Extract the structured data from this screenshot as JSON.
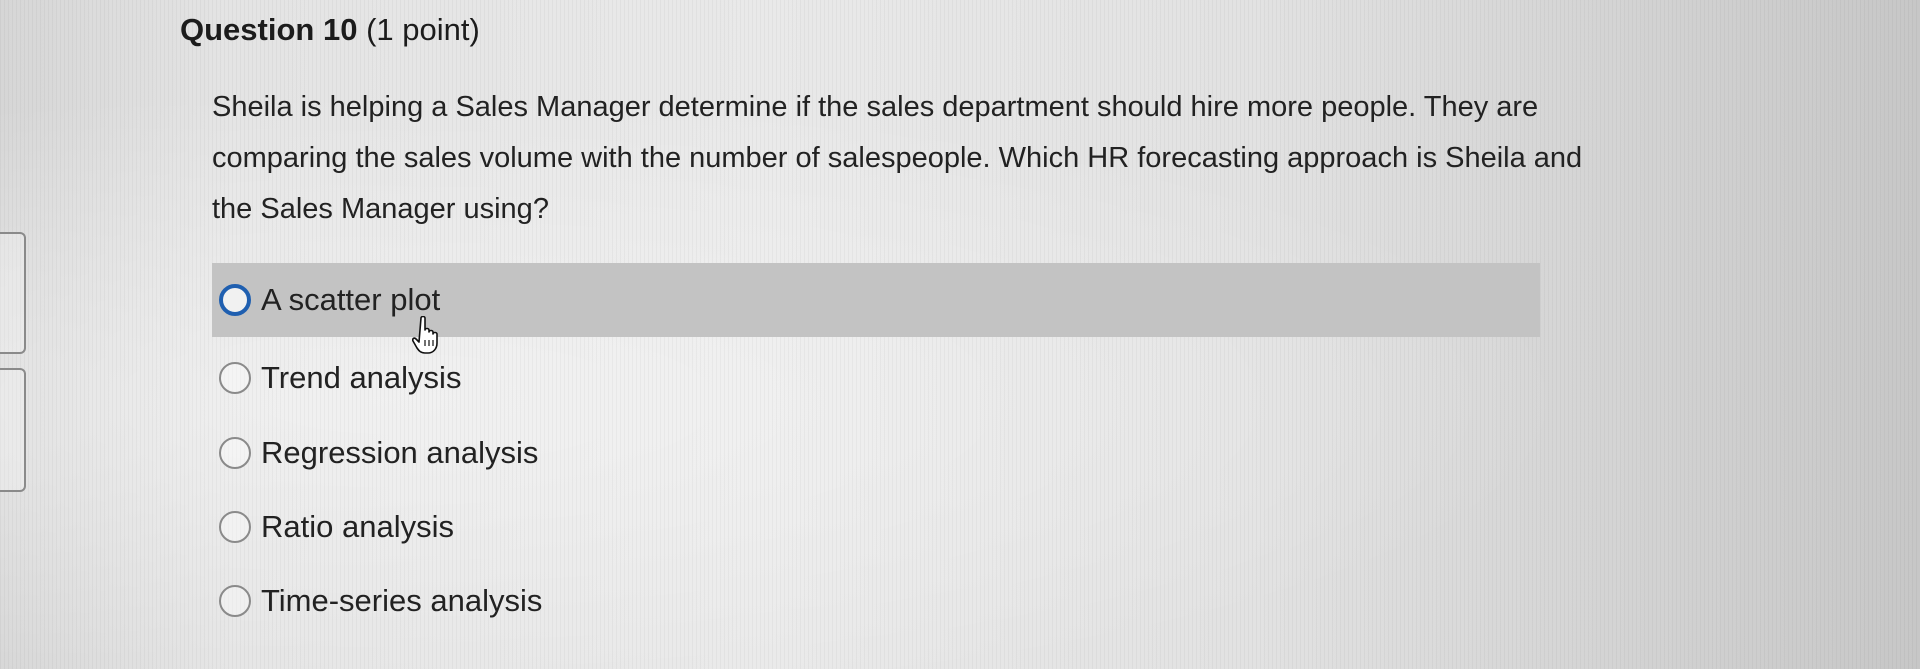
{
  "question": {
    "title": "Question 10",
    "points": "(1 point)",
    "text": "Sheila is helping a Sales Manager determine if the sales department should hire more people. They are comparing the sales volume with the number of salespeople. Which HR forecasting approach is Sheila and the Sales Manager using?"
  },
  "options": [
    {
      "label": "A scatter plot",
      "hovered": true
    },
    {
      "label": "Trend analysis"
    },
    {
      "label": "Regression analysis"
    },
    {
      "label": "Ratio analysis"
    },
    {
      "label": "Time-series analysis"
    }
  ],
  "colors": {
    "hover_background": "#c3c3c3",
    "radio_focus": "#1f5fb0"
  },
  "icons": {
    "cursor": "hand-pointer-icon"
  }
}
